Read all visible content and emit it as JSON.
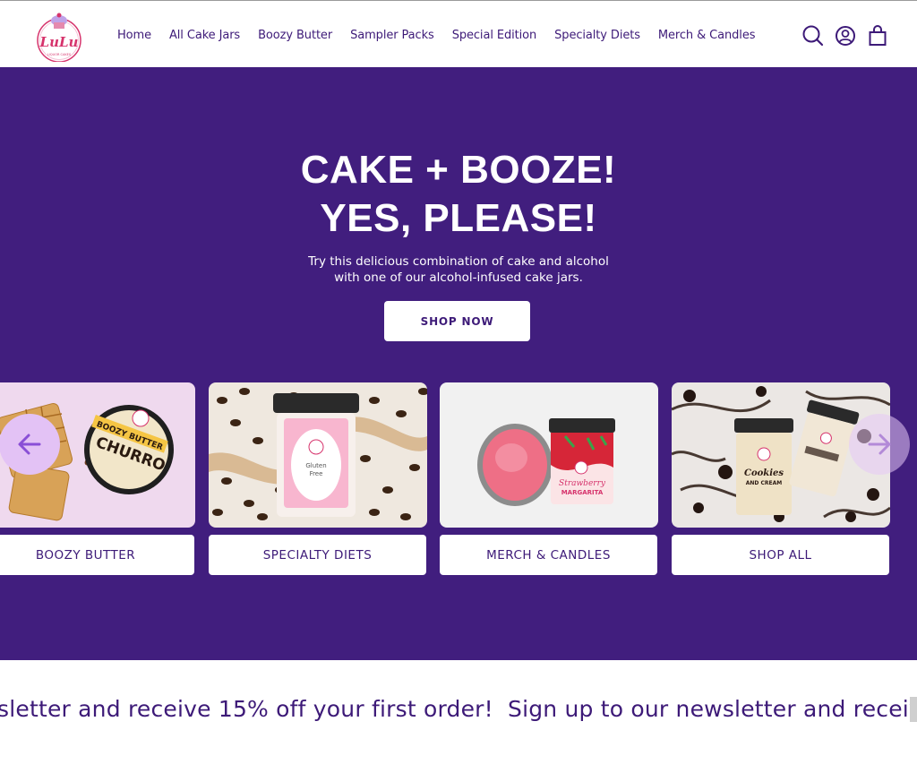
{
  "brand": {
    "name": "LuLu",
    "tagline": "LIQUOR CAKES",
    "accent": "#411e7e",
    "pink": "#d6336c"
  },
  "nav": {
    "items": [
      "Home",
      "All Cake Jars",
      "Boozy Butter",
      "Sampler Packs",
      "Special Edition",
      "Specialty Diets",
      "Merch & Candles"
    ]
  },
  "header_icons": [
    "search-icon",
    "account-icon",
    "cart-icon"
  ],
  "hero": {
    "title_line1": "CAKE + BOOZE!",
    "title_line2": "YES, PLEASE!",
    "subtitle_line1": "Try this delicious combination of cake and alcohol",
    "subtitle_line2": "with one of our alcohol-infused cake jars.",
    "cta": "SHOP NOW"
  },
  "collections": [
    {
      "label": "BOOZY BUTTER",
      "jar_text_1": "BOOZY BUTTER",
      "jar_text_2": "CHURRO"
    },
    {
      "label": "SPECIALTY DIETS",
      "jar_text_1": "Gluten",
      "jar_text_2": "Free"
    },
    {
      "label": "MERCH & CANDLES",
      "jar_text_1": "Strawberry",
      "jar_text_2": "MARGARITA"
    },
    {
      "label": "SHOP ALL",
      "jar_text_1": "Cookies",
      "jar_text_2": "AND CREAM"
    }
  ],
  "carousel": {
    "prev_icon": "arrow-left-icon",
    "next_icon": "arrow-right-icon"
  },
  "marquee": {
    "text_a": "sletter and receive 15% off your first order!",
    "text_b": "Sign up to our newsletter and receiv"
  }
}
